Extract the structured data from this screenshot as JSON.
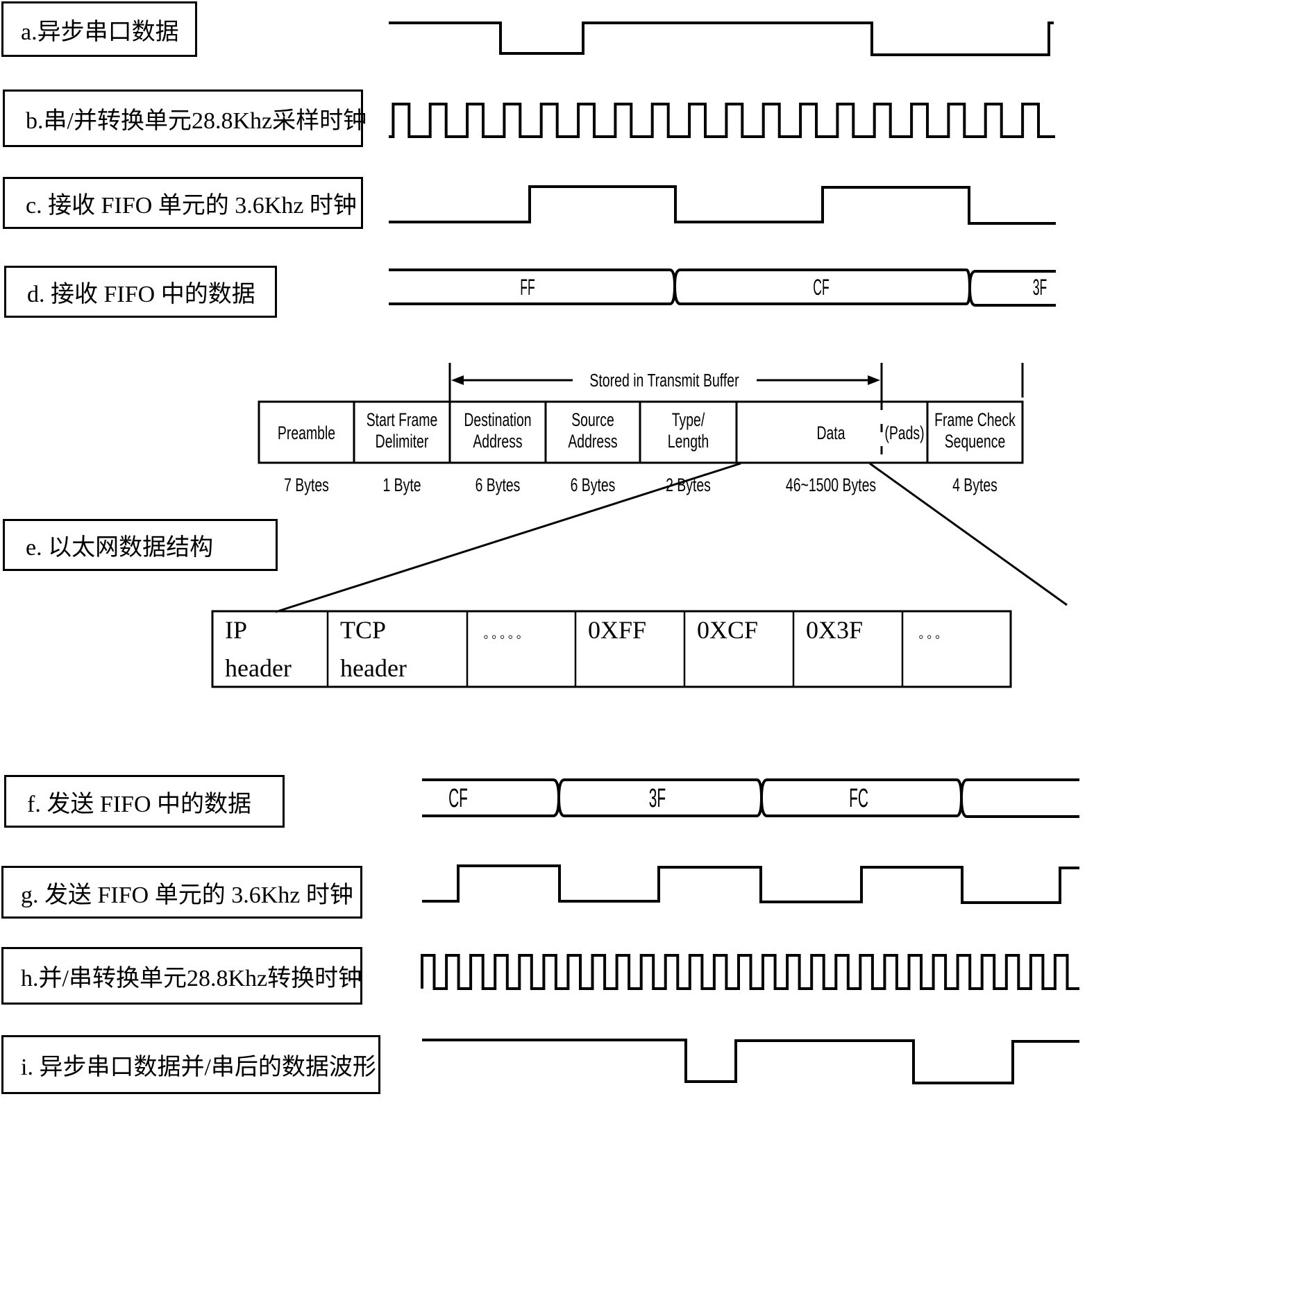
{
  "labels": {
    "a": "a.异步串口数据",
    "b": "b.串/并转换单元28.8Khz采样时钟",
    "c": "c.  接收 FIFO 单元的 3.6Khz 时钟",
    "d": "d.  接收 FIFO 中的数据",
    "e": "e.  以太网数据结构",
    "f": "f.  发送 FIFO 中的数据",
    "g": "g.  发送 FIFO 单元的 3.6Khz 时钟",
    "h": "h.并/串转换单元28.8Khz转换时钟",
    "i": "i.  异步串口数据并/串后的数据波形"
  },
  "receive_fifo_bytes": [
    "FF",
    "CF",
    "3F"
  ],
  "transmit_fifo_bytes": [
    "CF",
    "3F",
    "FC",
    ""
  ],
  "ethernet_frame": {
    "buffer_annotation": "Stored in Transmit Buffer",
    "fields": [
      {
        "name_line1": "Preamble",
        "name_line2": "",
        "size": "7 Bytes"
      },
      {
        "name_line1": "Start Frame",
        "name_line2": "Delimiter",
        "size": "1 Byte"
      },
      {
        "name_line1": "Destination",
        "name_line2": "Address",
        "size": "6 Bytes"
      },
      {
        "name_line1": "Source",
        "name_line2": "Address",
        "size": "6 Bytes"
      },
      {
        "name_line1": "Type/",
        "name_line2": "Length",
        "size": "2 Bytes"
      },
      {
        "name_line1": "Data",
        "name_line2": "",
        "size": "46~1500 Bytes"
      },
      {
        "name_line1": "(Pads)",
        "name_line2": "",
        "size": ""
      },
      {
        "name_line1": "Frame Check",
        "name_line2": "Sequence",
        "size": "4 Bytes"
      }
    ]
  },
  "data_payload": [
    {
      "line1": "IP",
      "line2": "header"
    },
    {
      "line1": "TCP",
      "line2": "header"
    },
    {
      "line1": "◦◦◦◦◦",
      "line2": ""
    },
    {
      "line1": "0XFF",
      "line2": ""
    },
    {
      "line1": "0XCF",
      "line2": ""
    },
    {
      "line1": "0X3F",
      "line2": ""
    },
    {
      "line1": "◦◦◦",
      "line2": ""
    }
  ],
  "signals": {
    "a_serial_levels": [
      1,
      0,
      1,
      1,
      1,
      0,
      0,
      1
    ],
    "b_sample_clock_cycles": 18,
    "c_rx_fifo_clock_cycles": 2,
    "g_tx_fifo_clock_cycles": 3,
    "h_conversion_clock_cycles": 27,
    "i_output_levels": [
      1,
      1,
      1,
      1,
      0,
      1,
      1,
      1,
      0,
      0,
      1
    ]
  }
}
